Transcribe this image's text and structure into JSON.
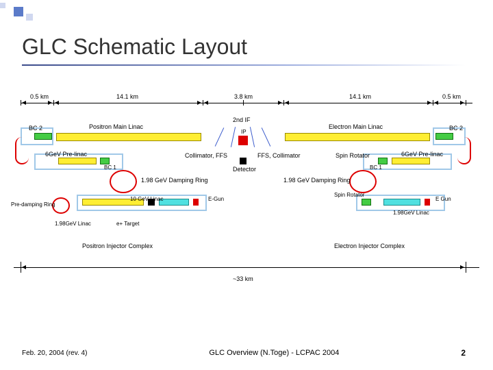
{
  "slide": {
    "title": "GLC Schematic Layout",
    "date": "Feb. 20, 2004 (rev. 4)",
    "center_footer": "GLC Overview (N.Toge) - LCPAC 2004",
    "page": "2"
  },
  "ruler": {
    "seg1": "0.5 km",
    "seg2": "14.1 km",
    "seg3": "3.8 km",
    "seg4": "14.1 km",
    "seg5": "0.5 km",
    "total": "~33 km"
  },
  "labels": {
    "posMainLinac": "Positron Main Linac",
    "elecMainLinac": "Electron Main Linac",
    "bc2_l": "BC 2",
    "bc2_r": "BC 2",
    "bc1_l": "BC 1",
    "bc1_r": "BC 1",
    "secondIF": "2nd IF",
    "ip": "IP",
    "collFFS_l": "Collimator, FFS",
    "collFFS_r": "FFS, Collimator",
    "detector": "Detector",
    "preLinac_l": "6GeV Pre-linac",
    "preLinac_r": "6GeV Pre-linac",
    "dr_l": "1.98 GeV Damping Ring",
    "dr_r": "1.98 GeV Damping Ring",
    "spinRot_l": "Spin Rotator",
    "spinRot_r": "Spin Rotator",
    "linac10": "10 GeV Linac",
    "linac198_l": "1.98GeV Linac",
    "linac198_r": "1.98GeV Linac",
    "preDamp": "Pre-damping Ring",
    "eTarget": "e+ Target",
    "egun_l": "E-Gun",
    "egun_r": "E Gun",
    "posInj": "Positron Injector Complex",
    "elecInj": "Electron Injector Complex"
  }
}
